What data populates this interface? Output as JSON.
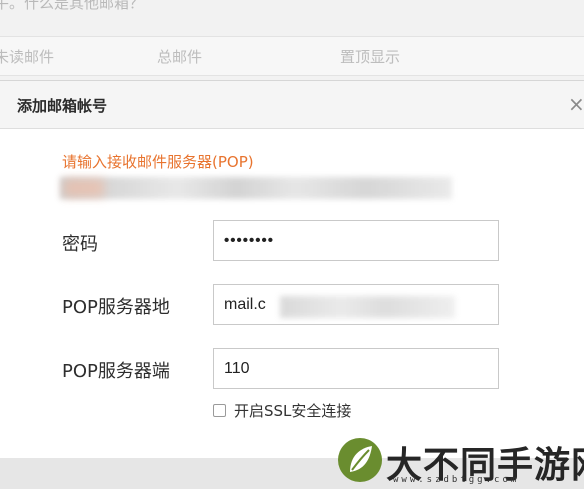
{
  "background": {
    "hint_text": "牛。什么是其他邮箱？",
    "tabs": [
      "未读邮件",
      "总邮件",
      "置顶显示"
    ]
  },
  "dialog": {
    "title": "添加邮箱帐号",
    "close_icon": "×",
    "instruction": "请输入接收邮件服务器(POP)",
    "fields": {
      "password": {
        "label": "密码",
        "value": "••••••••"
      },
      "pop_server": {
        "label": "POP服务器地",
        "value": "mail.c"
      },
      "pop_port": {
        "label": "POP服务器端",
        "value": "110"
      }
    },
    "ssl_checkbox": {
      "label": "开启SSL安全连接",
      "checked": false
    }
  },
  "watermark": {
    "brand": "大不同手游网",
    "url": "www.szdbtgg.com"
  },
  "colors": {
    "accent_orange": "#e8742f",
    "logo_green": "#6a8d2f"
  }
}
